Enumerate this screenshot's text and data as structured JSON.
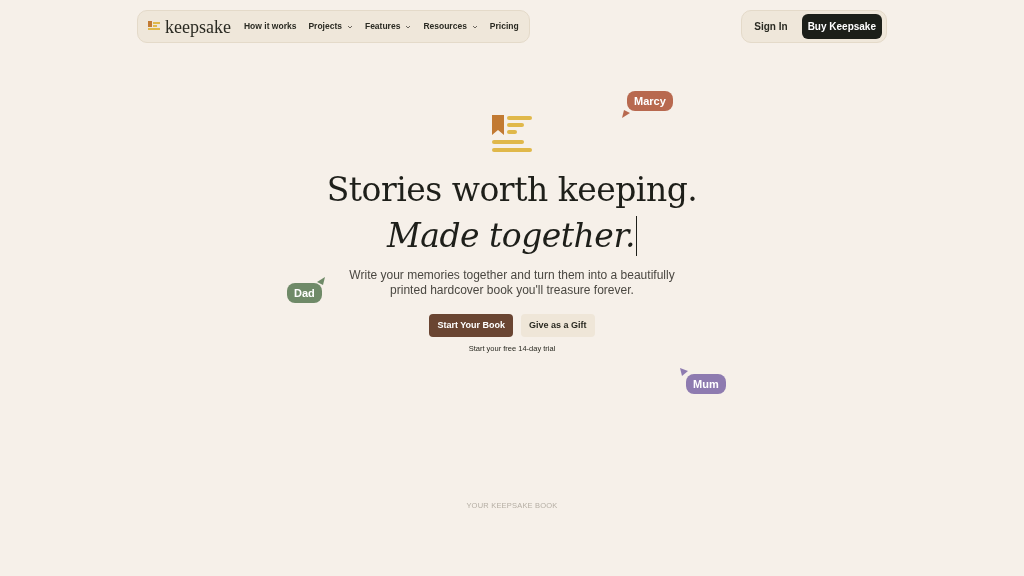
{
  "nav": {
    "brand": "keepsake",
    "links": [
      {
        "label": "How it works",
        "dropdown": false
      },
      {
        "label": "Projects",
        "dropdown": true
      },
      {
        "label": "Features",
        "dropdown": true
      },
      {
        "label": "Resources",
        "dropdown": true
      },
      {
        "label": "Pricing",
        "dropdown": false
      }
    ],
    "sign_in": "Sign In",
    "cta": "Buy Keepsake"
  },
  "hero": {
    "title": "Stories worth keeping.",
    "subtitle": "Made together.",
    "text": "Write your memories together and turn them into a beautifully printed hardcover book you'll treasure forever.",
    "primary_button": "Start Your Book",
    "secondary_button": "Give as a Gift",
    "note": "Start your free 14-day trial"
  },
  "cursors": [
    {
      "name": "Marcy",
      "color": "#b8694f"
    },
    {
      "name": "Dad",
      "color": "#6f8a68"
    },
    {
      "name": "Mum",
      "color": "#8e7bb0"
    }
  ],
  "section_label": "YOUR KEEPSAKE BOOK"
}
